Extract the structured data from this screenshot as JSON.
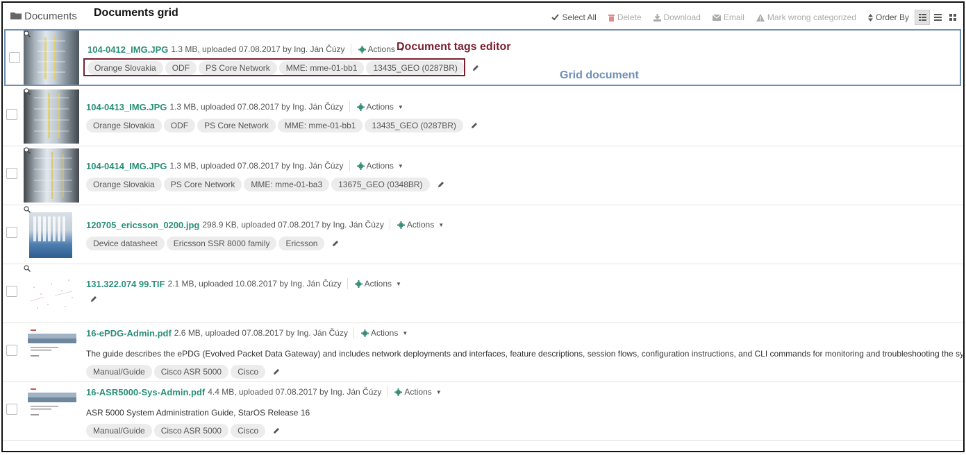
{
  "header": {
    "section_label": "Documents",
    "annotation": "Documents grid",
    "toolbar": {
      "select_all": "Select All",
      "delete": "Delete",
      "download": "Download",
      "email": "Email",
      "mark_wrong": "Mark wrong categorized",
      "order_by": "Order By"
    }
  },
  "annotations": {
    "tags_editor": "Document tags editor",
    "grid_document": "Grid document"
  },
  "colors": {
    "accent": "#2a8f78",
    "annotation_red": "#7a1f2f",
    "annotation_blue": "#6f8fb6"
  },
  "documents": [
    {
      "name": "104-0412_IMG.JPG",
      "meta": "1.3 MB, uploaded 07.08.2017 by Ing. Ján Čúzy",
      "actions": "Actions",
      "tags": [
        "Orange Slovakia",
        "ODF",
        "PS Core Network",
        "MME: mme-01-bb1",
        "13435_GEO (0287BR)"
      ],
      "description": ""
    },
    {
      "name": "104-0413_IMG.JPG",
      "meta": "1.3 MB, uploaded 07.08.2017 by Ing. Ján Čúzy",
      "actions": "Actions",
      "tags": [
        "Orange Slovakia",
        "ODF",
        "PS Core Network",
        "MME: mme-01-bb1",
        "13435_GEO (0287BR)"
      ],
      "description": ""
    },
    {
      "name": "104-0414_IMG.JPG",
      "meta": "1.3 MB, uploaded 07.08.2017 by Ing. Ján Čúzy",
      "actions": "Actions",
      "tags": [
        "Orange Slovakia",
        "PS Core Network",
        "MME: mme-01-ba3",
        "13675_GEO (0348BR)"
      ],
      "description": ""
    },
    {
      "name": "120705_ericsson_0200.jpg",
      "meta": "298.9 KB, uploaded 07.08.2017 by Ing. Ján Čúzy",
      "actions": "Actions",
      "tags": [
        "Device datasheet",
        "Ericsson SSR 8000 family",
        "Ericsson"
      ],
      "description": ""
    },
    {
      "name": "131.322.074 99.TIF",
      "meta": "2.1 MB, uploaded 10.08.2017 by Ing. Ján Čúzy",
      "actions": "Actions",
      "tags": [],
      "description": ""
    },
    {
      "name": "16-ePDG-Admin.pdf",
      "meta": "2.6 MB, uploaded 07.08.2017 by Ing. Ján Čúzy",
      "actions": "Actions",
      "tags": [
        "Manual/Guide",
        "Cisco ASR 5000",
        "Cisco"
      ],
      "description": "The guide describes the ePDG (Evolved Packet Data Gateway) and includes network deployments and interfaces, feature descriptions, session flows, configuration instructions, and CLI commands for monitoring and troubleshooting the system. It a..."
    },
    {
      "name": "16-ASR5000-Sys-Admin.pdf",
      "meta": "4.4 MB, uploaded 07.08.2017 by Ing. Ján Čúzy",
      "actions": "Actions",
      "tags": [
        "Manual/Guide",
        "Cisco ASR 5000",
        "Cisco"
      ],
      "description": "ASR 5000 System Administration Guide, StarOS Release 16"
    }
  ]
}
